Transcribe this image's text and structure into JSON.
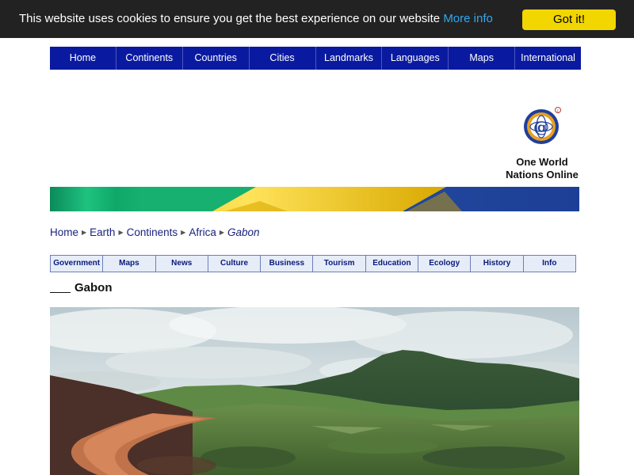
{
  "cookie_bar": {
    "message": "This website uses cookies to ensure you get the best experience on our website",
    "more_info_label": "More info",
    "button_label": "Got it!"
  },
  "main_nav": {
    "items": [
      {
        "label": "Home"
      },
      {
        "label": "Continents"
      },
      {
        "label": "Countries"
      },
      {
        "label": "Cities"
      },
      {
        "label": "Landmarks"
      },
      {
        "label": "Languages"
      },
      {
        "label": "Maps"
      },
      {
        "label": "International"
      }
    ]
  },
  "logo": {
    "line1": "One World",
    "line2": "Nations Online"
  },
  "breadcrumb": {
    "items": [
      {
        "label": "Home"
      },
      {
        "label": "Earth"
      },
      {
        "label": "Continents"
      },
      {
        "label": "Africa"
      }
    ],
    "current": "Gabon"
  },
  "sub_nav": {
    "items": [
      {
        "label": "Government"
      },
      {
        "label": "Maps"
      },
      {
        "label": "News"
      },
      {
        "label": "Culture"
      },
      {
        "label": "Business"
      },
      {
        "label": "Tourism"
      },
      {
        "label": "Education"
      },
      {
        "label": "Ecology"
      },
      {
        "label": "History"
      },
      {
        "label": "Info"
      }
    ]
  },
  "page": {
    "title": "Gabon"
  },
  "colors": {
    "nav_blue": "#0a1aa0",
    "flag_green": "#009e60",
    "flag_yellow": "#fcd116",
    "flag_blue": "#3a75c4",
    "cookie_button": "#f1d600"
  }
}
